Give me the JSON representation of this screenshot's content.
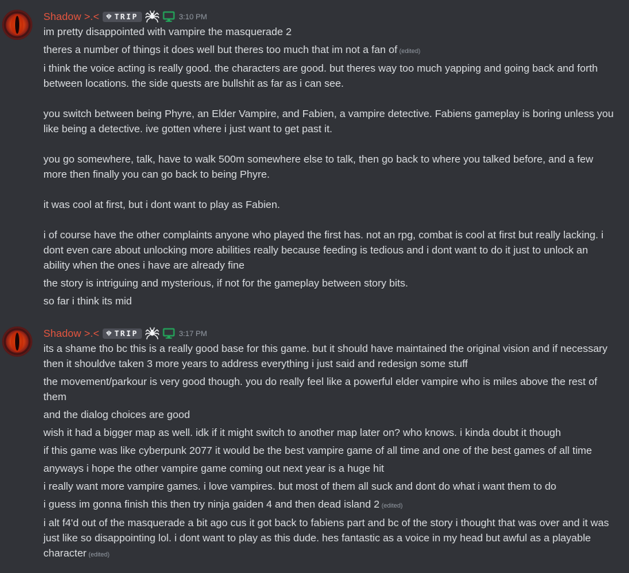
{
  "colors": {
    "background": "#313338",
    "username": "#e8563f",
    "text": "#dbdee1",
    "muted": "#949ba4",
    "tag_bg": "#4e5058",
    "status_green": "#23a55a"
  },
  "icons": {
    "tag": "gem-icon",
    "badge": "spider-icon",
    "status": "monitor-icon",
    "avatar": "eye-avatar"
  },
  "groups": [
    {
      "username": "Shadow >.<",
      "tag": "TRIP",
      "timestamp": "3:10 PM",
      "messages": [
        {
          "text": "im pretty disappointed with vampire the masquerade 2"
        },
        {
          "text": "theres a number of things it does well but theres too much that im not a fan of",
          "edited": "(edited)"
        },
        {
          "text": "i think the voice acting is really good. the characters are good. but theres way too much yapping and going back and forth between locations. the side quests are bullshit as far as i can see.\n\nyou switch between being Phyre, an Elder Vampire, and Fabien, a vampire detective. Fabiens gameplay is boring unless you like being a detective. ive gotten where i just want to get past it.\n\nyou go somewhere, talk, have to walk 500m somewhere else to talk, then go back to where you talked before, and a few more then finally you can go back to being Phyre.\n\nit was cool at first, but i dont want to play as Fabien.\n\ni of course have the other complaints anyone who played the first has. not an rpg, combat is cool at first but really lacking. i dont even care about unlocking more abilities really because feeding is tedious and i dont want to do it just to unlock an ability when the ones i have are already fine"
        },
        {
          "text": "the story is intriguing and mysterious, if not for the gameplay between story bits."
        },
        {
          "text": "so far i think its mid"
        }
      ]
    },
    {
      "username": "Shadow >.<",
      "tag": "TRIP",
      "timestamp": "3:17 PM",
      "messages": [
        {
          "text": "its a shame tho bc this is a really good base for this game. but it should have maintained the original vision and if necessary then it shouldve taken 3 more years to address everything i just said and redesign some stuff"
        },
        {
          "text": "the movement/parkour is very good though. you do really feel like a powerful elder vampire who is miles above the rest of them"
        },
        {
          "text": "and the dialog choices are good"
        },
        {
          "text": "wish it had a bigger map as well. idk if it might switch to another map later on? who knows. i kinda doubt it though"
        },
        {
          "text": "if this game was like cyberpunk 2077 it would be the best vampire game of all time and one of the best games of all time"
        },
        {
          "text": "anyways i hope the other vampire game coming out next year is a huge hit"
        },
        {
          "text": "i really want more vampire games. i love vampires. but most of them all suck and dont do what i want them to do"
        },
        {
          "text": "i guess im gonna finish this then try ninja gaiden 4 and then dead island 2",
          "edited": "(edited)"
        },
        {
          "text": "i alt f4'd out of the masquerade a bit ago cus it got back to fabiens part and bc of the story i thought that was over and it was just like so disappointing lol. i dont want to play as this dude. hes fantastic as a voice in my head but awful as a playable character",
          "edited": "(edited)"
        }
      ]
    }
  ]
}
